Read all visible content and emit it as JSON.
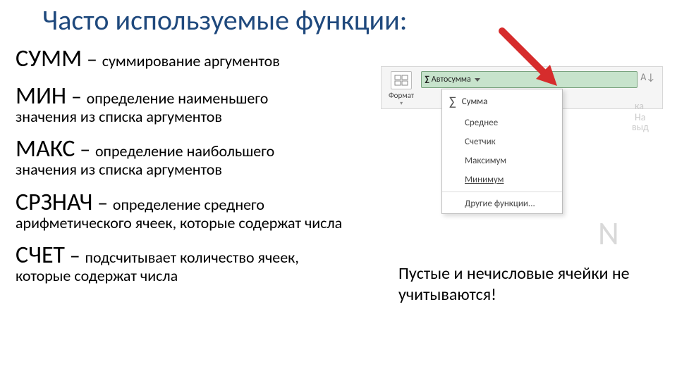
{
  "title": "Часто используемые функции:",
  "funcs": {
    "sum": {
      "name": "СУММ",
      "dash": " – ",
      "desc": "суммирование аргументов"
    },
    "min": {
      "name": "МИН",
      "dash": " – ",
      "desc": "определение наименьшего",
      "cont": "значения из списка аргументов"
    },
    "max": {
      "name": "МАКС",
      "dash": " – ",
      "desc": "определение наибольшего",
      "cont": "значения из списка аргументов"
    },
    "avg": {
      "name": "СРЗНАЧ",
      "dash": " – ",
      "desc": "определение среднего",
      "cont": "арифметического ячеек, которые содержат числа"
    },
    "count": {
      "name": "СЧЕТ",
      "dash": " – ",
      "desc": "подсчитывает количество ячеек,",
      "cont": "которые содержат числа"
    }
  },
  "ribbon": {
    "format": "Формат",
    "autosum": "Автосумма",
    "sigma": "∑",
    "sort_hint": "А↓",
    "na": "На",
    "vyd": "выд",
    "ka": "ка"
  },
  "menu": {
    "head": "Сумма",
    "items": [
      "Среднее",
      "Счетчик",
      "Максимум",
      "Минимум"
    ],
    "more": "Другие функции..."
  },
  "note": "Пустые и нечисловые ячейки не учитываются!",
  "bg_letter": "N"
}
